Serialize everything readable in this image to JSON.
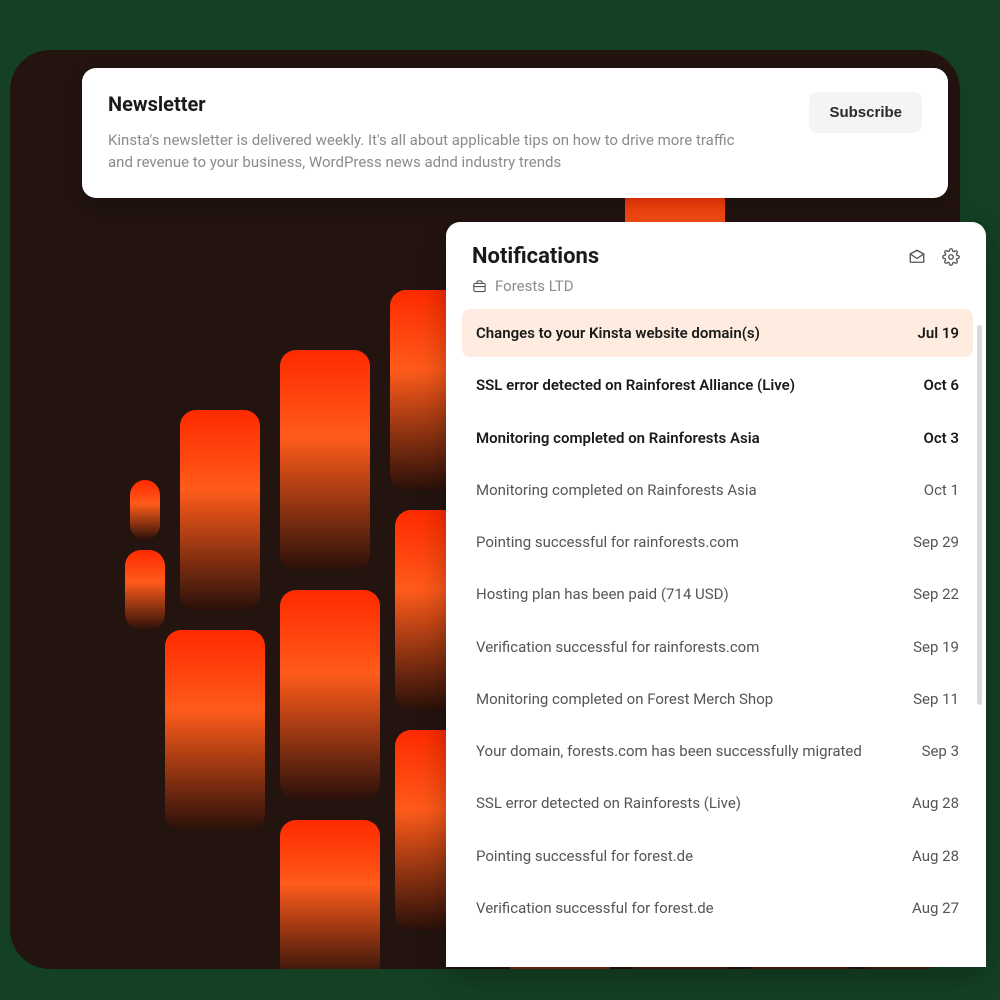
{
  "newsletter": {
    "title": "Newsletter",
    "description": "Kinsta's newsletter is delivered weekly. It's all about applicable tips on how to drive more traffic and revenue to your business, WordPress news adnd industry trends",
    "subscribe_label": "Subscribe"
  },
  "notifications": {
    "title": "Notifications",
    "company": "Forests LTD",
    "items": [
      {
        "subject": "Changes to your Kinsta website domain(s)",
        "date": "Jul 19",
        "highlighted": true
      },
      {
        "subject": "SSL error detected on Rainforest Alliance (Live)",
        "date": "Oct 6",
        "unread": true
      },
      {
        "subject": "Monitoring completed on Rainforests Asia",
        "date": "Oct 3",
        "unread": true
      },
      {
        "subject": "Monitoring completed on Rainforests Asia",
        "date": "Oct 1"
      },
      {
        "subject": "Pointing successful for rainforests.com",
        "date": "Sep 29"
      },
      {
        "subject": "Hosting plan has been paid (714 USD)",
        "date": "Sep 22"
      },
      {
        "subject": "Verification successful for rainforests.com",
        "date": "Sep 19"
      },
      {
        "subject": "Monitoring completed on Forest Merch Shop",
        "date": "Sep 11"
      },
      {
        "subject": "Your domain, forests.com has been successfully migrated",
        "date": "Sep 3"
      },
      {
        "subject": "SSL error detected on Rainforests (Live)",
        "date": "Aug 28"
      },
      {
        "subject": "Pointing successful for forest.de",
        "date": "Aug 28"
      },
      {
        "subject": "Verification successful for forest.de",
        "date": "Aug 27"
      }
    ]
  }
}
